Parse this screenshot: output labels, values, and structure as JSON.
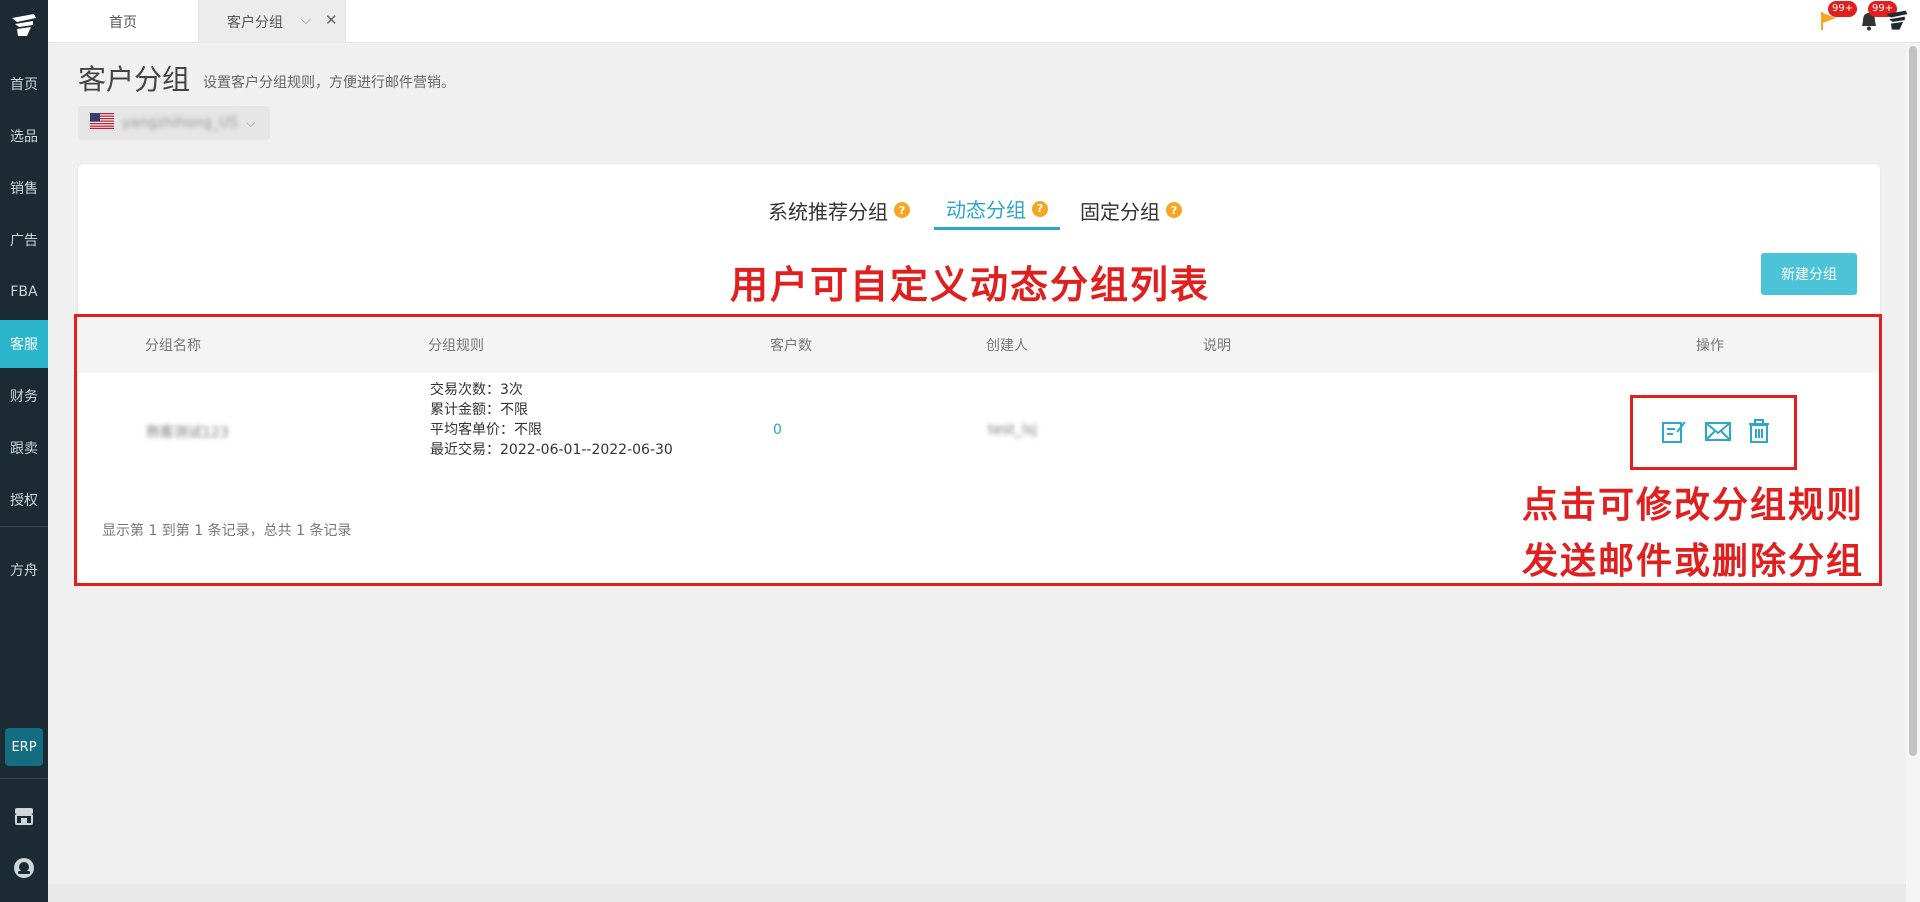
{
  "sidebar": {
    "items": [
      {
        "label": "首页"
      },
      {
        "label": "选品"
      },
      {
        "label": "销售"
      },
      {
        "label": "广告"
      },
      {
        "label": "FBA"
      },
      {
        "label": "客服"
      },
      {
        "label": "财务"
      },
      {
        "label": "跟卖"
      },
      {
        "label": "授权"
      },
      {
        "label": "方舟"
      }
    ],
    "active_label": "客服",
    "erp_label": "ERP"
  },
  "topbar": {
    "tabs": [
      {
        "label": "首页"
      },
      {
        "label": "客户分组"
      }
    ],
    "flag_badge": "99+",
    "bell_badge": "99+"
  },
  "page": {
    "title": "客户分组",
    "description": "设置客户分组规则，方便进行邮件营销。",
    "store_name": "yangzhihong_US"
  },
  "group_tabs": [
    {
      "label": "系统推荐分组"
    },
    {
      "label": "动态分组"
    },
    {
      "label": "固定分组"
    }
  ],
  "annotations": {
    "title": "用户可自定义动态分组列表",
    "ops_line1": "点击可修改分组规则",
    "ops_line2": "发送邮件或删除分组"
  },
  "new_group_button": "新建分组",
  "table": {
    "headers": [
      "分组名称",
      "分组规则",
      "客户数",
      "创建人",
      "说明",
      "操作"
    ],
    "rows": [
      {
        "name": "熟客测试123",
        "rules": [
          "交易次数：3次",
          "累计金额：不限",
          "平均客单价：不限",
          "最近交易：2022-06-01--2022-06-30"
        ],
        "count": "0",
        "creator": "test_lsj",
        "note": ""
      }
    ],
    "footer": "显示第 1 到第 1 条记录，总共 1 条记录"
  },
  "colors": {
    "accent": "#2ba7c7",
    "sidebar_bg": "#1b2a33",
    "annotation_red": "#e0201f",
    "help_orange": "#f5a623"
  }
}
